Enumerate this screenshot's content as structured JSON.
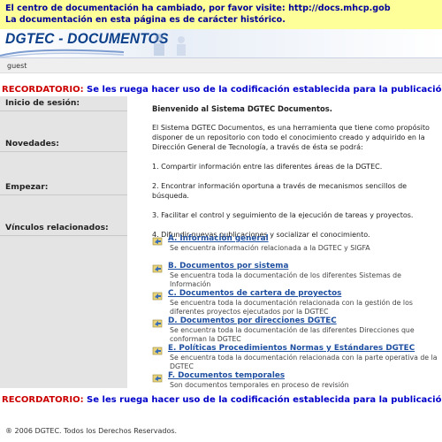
{
  "notice": {
    "line1_prefix": "El centro de documentación ha cambiado, por favor visite: ",
    "line1_link": "http://docs.mhcp.gob",
    "line2": "La documentación en esta página es de carácter histórico."
  },
  "banner": {
    "logo_text": "DGTEC - DOCUMENTOS"
  },
  "user": {
    "name": "guest"
  },
  "reminder": {
    "tag": "RECORDATORIO:",
    "message": " Se les ruega hacer uso de la codificación establecida para la publicación de docu"
  },
  "sidebar": {
    "sections": [
      {
        "label": "Inicio de sesión:"
      },
      {
        "label": "Novedades:"
      },
      {
        "label": "Empezar:"
      },
      {
        "label": "Vínculos relacionados:"
      }
    ]
  },
  "main": {
    "welcome": "Bienvenido al Sistema DGTEC Documentos.",
    "intro": "El Sistema DGTEC Documentos, es una herramienta que tiene como propósito disponer de un repositorio con todo el conocimiento creado y adquirido en la Dirección General de Tecnología, a través de ésta se podrá:",
    "points": [
      "1. Compartir información entre las diferentes áreas de la DGTEC.",
      "2. Encontrar información oportuna a través de mecanismos sencillos de búsqueda.",
      "3. Facilitar el control y seguimiento de la ejecución de tareas y proyectos.",
      "4. Difundir nuevas publicaciones y socializar el conocimiento."
    ]
  },
  "links": [
    {
      "title": "A. Información general",
      "desc": "Se encuentra información relacionada a la DGTEC y SIGFA"
    },
    {
      "title": "B. Documentos por sistema",
      "desc": "Se encuentra toda la documentación de los diferentes Sistemas de Información"
    },
    {
      "title": "C. Documentos de cartera de proyectos",
      "desc": "Se encuentra toda la documentación relacionada con la gestión de los diferentes proyectos ejecutados por la DGTEC"
    },
    {
      "title": "D. Documentos por direcciones DGTEC",
      "desc": "Se encuentra toda la documentación de las diferentes Direcciones que conforman la DGTEC"
    },
    {
      "title": "E. Políticas Procedimientos Normas y Estándares DGTEC",
      "desc": "Se encuentra toda la documentación relacionada con la parte operativa de la DGTEC"
    },
    {
      "title": "F. Documentos temporales",
      "desc": "Son documentos temporales en proceso de revisión"
    }
  ],
  "footer": {
    "copyright": "® 2006 DGTEC. Todos los Derechos Reservados."
  },
  "colors": {
    "notice_bg": "#ffff99",
    "reminder_tag": "#cc0000",
    "reminder_msg": "#0000cc",
    "link_title": "#1f4fa0",
    "sidebar_bg": "#e4e4e4"
  }
}
